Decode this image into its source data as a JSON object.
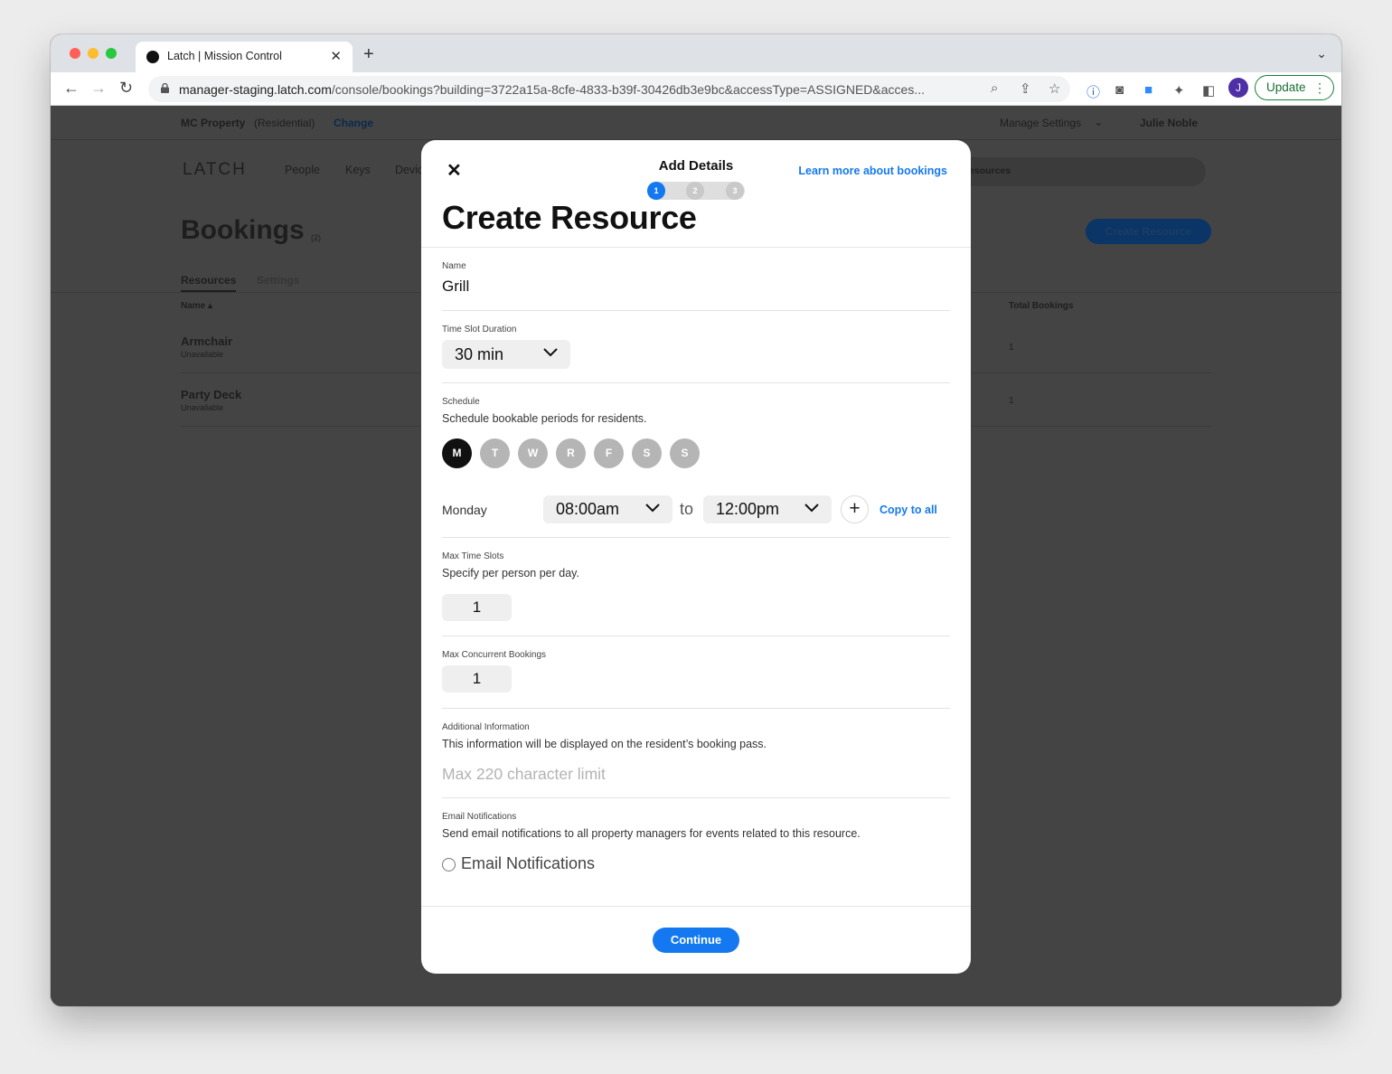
{
  "browser": {
    "tab_title": "Latch | Mission Control",
    "url_host": "manager-staging.latch.com",
    "url_path": "/console/bookings?building=3722a15a-8cfe-4833-b39f-30426db3e9bc&accessType=ASSIGNED&acces...",
    "profile_initial": "J",
    "update_label": "Update"
  },
  "page": {
    "property_name": "MC Property",
    "property_type": "(Residential)",
    "change_link": "Change",
    "manage_settings": "Manage Settings",
    "user_name": "Julie Noble",
    "logo": "LATCH",
    "nav": [
      "People",
      "Keys",
      "Devic"
    ],
    "search_partial": "esources",
    "heading": "Bookings",
    "heading_count": "(2)",
    "create_button": "Create Resource",
    "tabs": [
      "Resources",
      "Settings"
    ],
    "columns": {
      "name": "Name ▴",
      "total": "Total Bookings"
    },
    "rows": [
      {
        "name": "Armchair",
        "status": "Unavailable",
        "total": "1"
      },
      {
        "name": "Party Deck",
        "status": "Unavailable",
        "total": "1"
      }
    ]
  },
  "modal": {
    "step_title": "Add Details",
    "steps": [
      "1",
      "2",
      "3"
    ],
    "learn_more": "Learn more about bookings",
    "title": "Create Resource",
    "name": {
      "label": "Name",
      "value": "Grill"
    },
    "duration": {
      "label": "Time Slot Duration",
      "value": "30 min"
    },
    "schedule": {
      "label": "Schedule",
      "description": "Schedule bookable periods for residents.",
      "days": [
        "M",
        "T",
        "W",
        "R",
        "F",
        "S",
        "S"
      ],
      "selected_day_index": 0,
      "day_name": "Monday",
      "start": "08:00am",
      "to": "to",
      "end": "12:00pm",
      "copy_all": "Copy to all"
    },
    "max_slots": {
      "label": "Max Time Slots",
      "description": "Specify per person per day.",
      "value": "1"
    },
    "max_concurrent": {
      "label": "Max Concurrent Bookings",
      "value": "1"
    },
    "additional": {
      "label": "Additional Information",
      "description": "This information will be displayed on the resident’s booking pass.",
      "placeholder": "Max 220 character limit"
    },
    "email": {
      "label": "Email Notifications",
      "description": "Send email notifications to all property managers for events related to this resource.",
      "option": "Email Notifications",
      "checked": false
    },
    "continue": "Continue"
  },
  "colors": {
    "accent": "#1479f0",
    "overlay": "#444444"
  }
}
